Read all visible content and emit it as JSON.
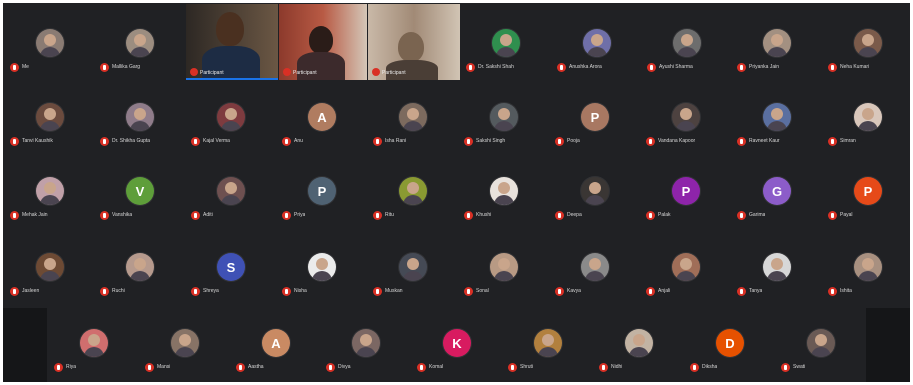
{
  "meeting": {
    "video_tiles": [
      {
        "name": "Participant",
        "speaking": true
      },
      {
        "name": "Participant",
        "speaking": false
      },
      {
        "name": "Participant",
        "speaking": false
      }
    ],
    "rows": [
      [
        {
          "name": "Me",
          "avatar_type": "photo",
          "bg": "#8a7b73"
        },
        {
          "name": "Mallika Garg",
          "avatar_type": "photo",
          "bg": "#9c8d80"
        },
        {
          "name": "Dr. Sakshi Shah",
          "avatar_type": "photo",
          "bg": "#2f8f4e"
        },
        {
          "name": "Anushka Arora",
          "avatar_type": "photo",
          "bg": "#6f6fa8"
        },
        {
          "name": "Ayushi Sharma",
          "avatar_type": "photo",
          "bg": "#6d6d6d"
        },
        {
          "name": "Priyanka Jain",
          "avatar_type": "photo",
          "bg": "#a39081"
        },
        {
          "name": "Neha Kumari",
          "avatar_type": "photo",
          "bg": "#7a5a4a"
        }
      ],
      [
        {
          "name": "Tanvi Kaushik",
          "avatar_type": "photo",
          "bg": "#6b4b3e"
        },
        {
          "name": "Dr. Shikha Gupta",
          "avatar_type": "photo",
          "bg": "#8f7c8a"
        },
        {
          "name": "Kajal Verma",
          "avatar_type": "photo",
          "bg": "#7e3b3f"
        },
        {
          "name": "Anu",
          "avatar_type": "initial",
          "initial": "A",
          "bg": "#b07c60"
        },
        {
          "name": "Isha Rani",
          "avatar_type": "photo",
          "bg": "#7c6a5e"
        },
        {
          "name": "Sakshi Singh",
          "avatar_type": "photo",
          "bg": "#545a5e"
        },
        {
          "name": "Pooja",
          "avatar_type": "initial",
          "initial": "P",
          "bg": "#a87862"
        },
        {
          "name": "Vandana Kapoor",
          "avatar_type": "photo",
          "bg": "#4d4240"
        },
        {
          "name": "Ravneet Kaur",
          "avatar_type": "photo",
          "bg": "#5a6fa0"
        },
        {
          "name": "Simran",
          "avatar_type": "photo",
          "bg": "#d9c7bb"
        }
      ],
      [
        {
          "name": "Mehak Jain",
          "avatar_type": "photo",
          "bg": "#c0a0a8"
        },
        {
          "name": "Vanshika",
          "avatar_type": "initial",
          "initial": "V",
          "bg": "#5e9e3a"
        },
        {
          "name": "Aditi",
          "avatar_type": "photo",
          "bg": "#6e5050"
        },
        {
          "name": "Priya",
          "avatar_type": "initial",
          "initial": "P",
          "bg": "#4f6273"
        },
        {
          "name": "Ritu",
          "avatar_type": "photo",
          "bg": "#8a9a32"
        },
        {
          "name": "Khushi",
          "avatar_type": "photo",
          "bg": "#e8e2dc"
        },
        {
          "name": "Deepa",
          "avatar_type": "photo",
          "bg": "#3a3634"
        },
        {
          "name": "Palak",
          "avatar_type": "initial",
          "initial": "P",
          "bg": "#8e24aa"
        },
        {
          "name": "Garima",
          "avatar_type": "initial",
          "initial": "G",
          "bg": "#8c5cc9"
        },
        {
          "name": "Payal",
          "avatar_type": "initial",
          "initial": "P",
          "bg": "#e64a19"
        }
      ],
      [
        {
          "name": "Jasleen",
          "avatar_type": "photo",
          "bg": "#6d4a34"
        },
        {
          "name": "Ruchi",
          "avatar_type": "photo",
          "bg": "#b69a8d"
        },
        {
          "name": "Shreya",
          "avatar_type": "initial",
          "initial": "S",
          "bg": "#3f51b5"
        },
        {
          "name": "Nisha",
          "avatar_type": "photo",
          "bg": "#ebebeb"
        },
        {
          "name": "Muskan",
          "avatar_type": "photo",
          "bg": "#454a55"
        },
        {
          "name": "Sonal",
          "avatar_type": "photo",
          "bg": "#b89a84"
        },
        {
          "name": "Kavya",
          "avatar_type": "photo",
          "bg": "#8a8a8a"
        },
        {
          "name": "Anjali",
          "avatar_type": "photo",
          "bg": "#a06e58"
        },
        {
          "name": "Tanya",
          "avatar_type": "photo",
          "bg": "#d7d7d7"
        },
        {
          "name": "Ishita",
          "avatar_type": "photo",
          "bg": "#a89080"
        }
      ],
      [
        {
          "name": "Riya",
          "avatar_type": "photo",
          "bg": "#d06e6e"
        },
        {
          "name": "Mansi",
          "avatar_type": "photo",
          "bg": "#877366"
        },
        {
          "name": "Aastha",
          "avatar_type": "initial",
          "initial": "A",
          "bg": "#c98a63"
        },
        {
          "name": "Divya",
          "avatar_type": "photo",
          "bg": "#7b6763"
        },
        {
          "name": "Komal",
          "avatar_type": "initial",
          "initial": "K",
          "bg": "#d81b60"
        },
        {
          "name": "Shruti",
          "avatar_type": "photo",
          "bg": "#b2803e"
        },
        {
          "name": "Nidhi",
          "avatar_type": "photo",
          "bg": "#c2b3a3"
        },
        {
          "name": "Diksha",
          "avatar_type": "initial",
          "initial": "D",
          "bg": "#e65100"
        },
        {
          "name": "Swati",
          "avatar_type": "photo",
          "bg": "#6a5a55"
        }
      ]
    ],
    "colors": {
      "background": "#202124",
      "mic_muted": "#d93025",
      "speaking_border": "#1a73e8",
      "name_text": "#d8d8d8"
    }
  }
}
